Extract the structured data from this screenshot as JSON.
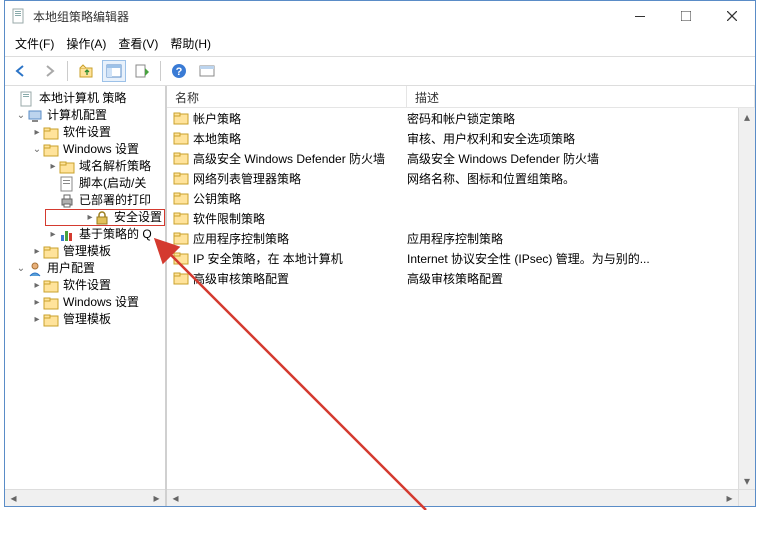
{
  "window": {
    "title": "本地组策略编辑器"
  },
  "menu": {
    "file": "文件(F)",
    "action": "操作(A)",
    "view": "查看(V)",
    "help": "帮助(H)"
  },
  "tree": {
    "root": "本地计算机 策略",
    "computer_config": "计算机配置",
    "software_settings": "软件设置",
    "windows_settings": "Windows 设置",
    "name_res_policy": "域名解析策略",
    "scripts": "脚本(启动/关",
    "deployed_printers": "已部署的打印",
    "security_settings": "安全设置",
    "policy_based": "基于策略的 Q",
    "admin_templates": "管理模板",
    "user_config": "用户配置",
    "u_software_settings": "软件设置",
    "u_windows_settings": "Windows 设置",
    "u_admin_templates": "管理模板"
  },
  "columns": {
    "name": "名称",
    "desc": "描述"
  },
  "rows": [
    {
      "name": "帐户策略",
      "desc": "密码和帐户锁定策略"
    },
    {
      "name": "本地策略",
      "desc": "审核、用户权利和安全选项策略"
    },
    {
      "name": "高级安全 Windows Defender 防火墙",
      "desc": "高级安全 Windows Defender 防火墙"
    },
    {
      "name": "网络列表管理器策略",
      "desc": "网络名称、图标和位置组策略。"
    },
    {
      "name": "公钥策略",
      "desc": ""
    },
    {
      "name": "软件限制策略",
      "desc": ""
    },
    {
      "name": "应用程序控制策略",
      "desc": "应用程序控制策略"
    },
    {
      "name": "IP 安全策略，在 本地计算机",
      "desc": "Internet 协议安全性 (IPsec) 管理。为与别的..."
    },
    {
      "name": "高级审核策略配置",
      "desc": "高级审核策略配置"
    }
  ]
}
